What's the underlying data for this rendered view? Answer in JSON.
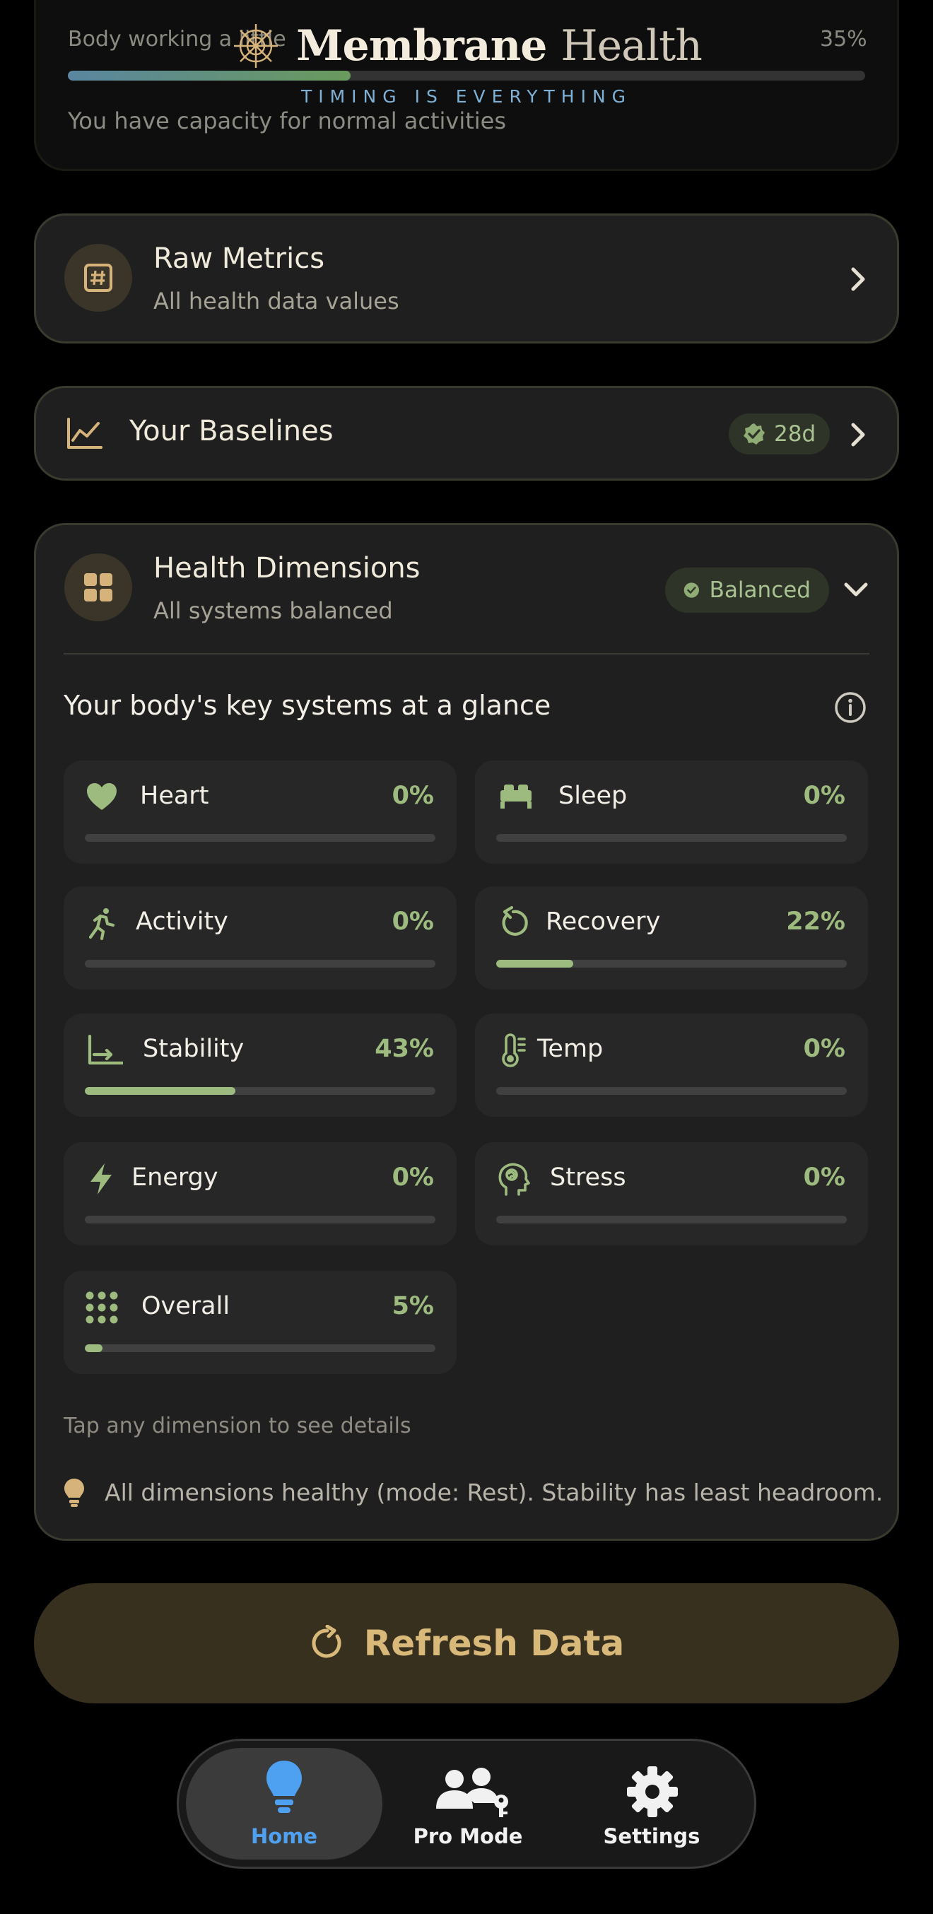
{
  "app": {
    "brand_bold": "Membrane",
    "brand_light": "Health",
    "tagline": "TIMING IS EVERYTHING"
  },
  "prev_card": {
    "title": "Body working a little",
    "percent": "35%",
    "caption": "You have capacity for normal activities"
  },
  "raw_metrics": {
    "title": "Raw Metrics",
    "subtitle": "All health data values",
    "icon": "hash-icon"
  },
  "baselines": {
    "title": "Your Baselines",
    "badge": "28d",
    "icon": "chart-line-icon"
  },
  "health_dimensions": {
    "title": "Health Dimensions",
    "subtitle": "All systems balanced",
    "status": "Balanced",
    "heading": "Your body's key systems at a glance",
    "items": [
      {
        "label": "Heart",
        "percent": "0%",
        "value": 0,
        "icon": "heart-icon"
      },
      {
        "label": "Sleep",
        "percent": "0%",
        "value": 0,
        "icon": "bed-icon"
      },
      {
        "label": "Activity",
        "percent": "0%",
        "value": 0,
        "icon": "running-icon"
      },
      {
        "label": "Recovery",
        "percent": "22%",
        "value": 22,
        "icon": "rotate-icon"
      },
      {
        "label": "Stability",
        "percent": "43%",
        "value": 43,
        "icon": "chart-axis-icon"
      },
      {
        "label": "Temp",
        "percent": "0%",
        "value": 0,
        "icon": "thermometer-icon"
      },
      {
        "label": "Energy",
        "percent": "0%",
        "value": 0,
        "icon": "bolt-icon"
      },
      {
        "label": "Stress",
        "percent": "0%",
        "value": 0,
        "icon": "brain-head-icon"
      },
      {
        "label": "Overall",
        "percent": "5%",
        "value": 5,
        "icon": "grid-dots-icon"
      }
    ],
    "hint": "Tap any dimension to see details",
    "insight": "All dimensions healthy (mode: Rest). Stability has least headroom."
  },
  "refresh_button": {
    "label": "Refresh Data"
  },
  "nav": {
    "items": [
      {
        "label": "Home",
        "icon": "lightbulb-icon",
        "active": true
      },
      {
        "label": "Pro Mode",
        "icon": "users-key-icon",
        "active": false
      },
      {
        "label": "Settings",
        "icon": "gear-icon",
        "active": false
      }
    ]
  },
  "colors": {
    "accent_green": "#9dbb7e",
    "accent_gold": "#d9b97a",
    "active_blue": "#4ea0f0",
    "background": "#000000"
  }
}
